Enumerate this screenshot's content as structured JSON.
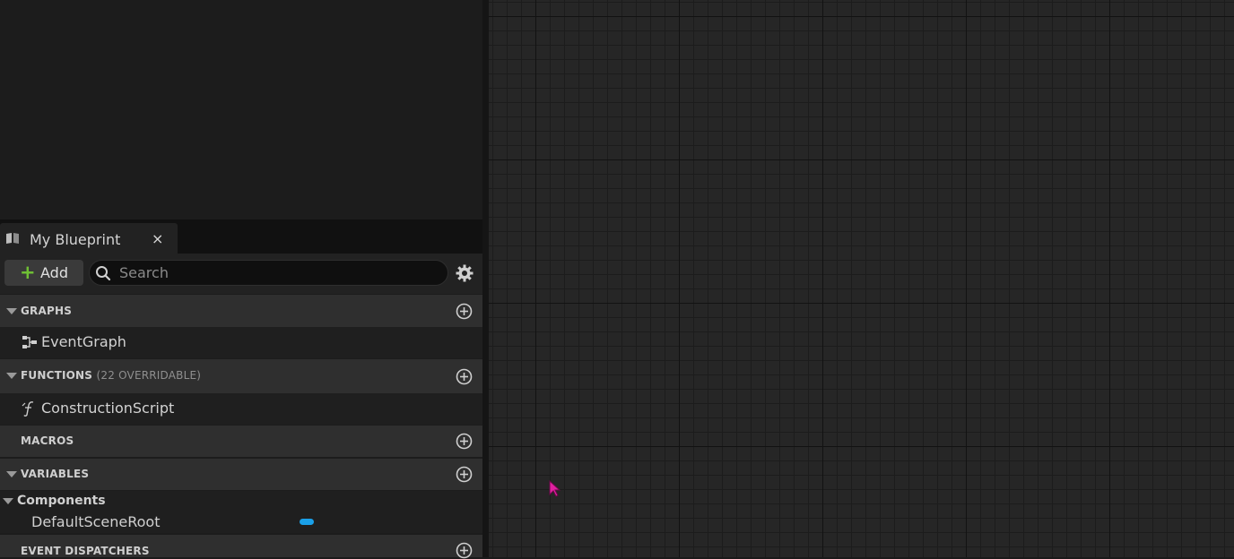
{
  "tab": {
    "title": "My Blueprint",
    "close": "×"
  },
  "toolbar": {
    "add_icon": "+",
    "add_label": "Add",
    "search_placeholder": "Search"
  },
  "sections": {
    "graphs": {
      "title": "GRAPHS",
      "items": [
        "EventGraph"
      ]
    },
    "functions": {
      "title": "FUNCTIONS",
      "subtitle": "(22 OVERRIDABLE)",
      "items": [
        "ConstructionScript"
      ]
    },
    "macros": {
      "title": "MACROS"
    },
    "variables": {
      "title": "VARIABLES",
      "category": "Components",
      "items": [
        {
          "name": "DefaultSceneRoot",
          "type_color": "#1aa0e8"
        }
      ]
    },
    "event_dispatchers": {
      "title": "EVENT DISPATCHERS"
    }
  },
  "icons": {
    "tab": "blueprint-book-icon",
    "search": "magnifier-icon",
    "settings": "gear-icon",
    "section_add": "add-circle-icon",
    "event_graph": "event-graph-icon",
    "function": "function-icon"
  },
  "colors": {
    "accent_add": "#6fbf34",
    "component_pill": "#1aa0e8",
    "cursor": "#e020a0"
  }
}
